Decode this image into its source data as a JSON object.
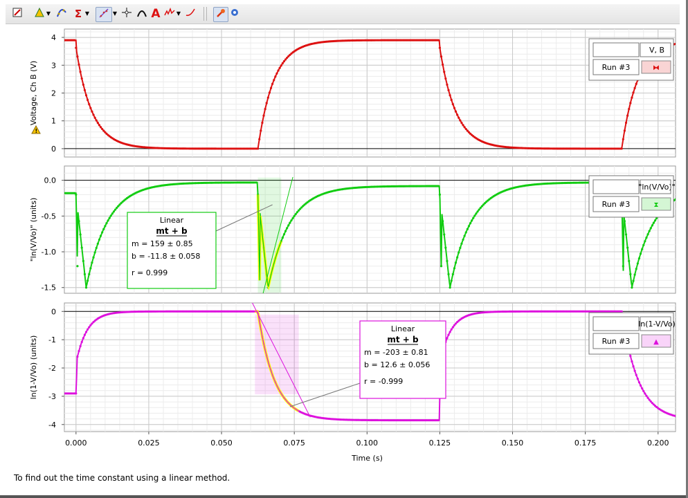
{
  "toolbar": {
    "icons": [
      "view-options-icon",
      "analyze-icon",
      "curve-fit-icon",
      "statistics-icon",
      "integral-icon",
      "linear-fit-icon",
      "crosshair-icon",
      "tangent-icon",
      "annotation-icon",
      "interpolate-icon",
      "model-icon",
      "autoscale-icon",
      "graph-settings-icon"
    ],
    "annotation_glyph": "A",
    "statistics_glyph": "Σ"
  },
  "footer_text": "To find out the time constant using a linear method.",
  "colors": {
    "red": "#dd1111",
    "green": "#11cc11",
    "magenta": "#dd11dd",
    "fit_highlight": "#ffff00",
    "grid_major": "#c8c8c8",
    "grid_minor": "#ececec"
  },
  "chart_data": [
    {
      "type": "line",
      "ylabel": "Voltage, Ch B (V)",
      "xlabel": "",
      "xlim": [
        -0.004,
        0.206
      ],
      "ylim": [
        -0.3,
        4.3
      ],
      "yticks": [
        "0",
        "1",
        "2",
        "3",
        "4"
      ],
      "ytick_values": [
        0,
        1,
        2,
        3,
        4
      ],
      "series": [
        {
          "name": "Run #3",
          "color": "#dd1111",
          "model": "rc_voltage",
          "V0": 3.9,
          "tau": 0.0055,
          "period": 0.125
        }
      ],
      "legend": {
        "header": "V, B",
        "run": "Run #3",
        "symbol": "⧓",
        "placement": "top-right"
      }
    },
    {
      "type": "line",
      "ylabel": "\"ln(V/Vo)\" (units)",
      "xlabel": "",
      "xlim": [
        -0.004,
        0.206
      ],
      "ylim": [
        -1.58,
        0.2
      ],
      "yticks": [
        "0.0",
        "-0.5",
        "-1.0",
        "-1.5"
      ],
      "ytick_values": [
        0,
        -0.5,
        -1.0,
        -1.5
      ],
      "series": [
        {
          "name": "Run #3",
          "color": "#11cc11",
          "model": "ln_v",
          "period": 0.125
        }
      ],
      "legend": {
        "header": "\"ln(V/Vo)\"",
        "run": "Run #3",
        "symbol": "⧗",
        "placement": "top-right"
      },
      "fit": {
        "title": "Linear",
        "formula": "mt + b",
        "m_line": "m = 159   ± 0.85",
        "b_line": "b  = -11.8 ± 0.058",
        "r_line": "r = 0.999",
        "m": 159,
        "b": -11.8,
        "x_range": [
          0.0625,
          0.0705
        ],
        "color": "#11cc11"
      }
    },
    {
      "type": "line",
      "ylabel": "ln(1-V/Vo) (units)",
      "xlabel": "Time (s)",
      "xlim": [
        -0.004,
        0.206
      ],
      "ylim": [
        -4.25,
        0.3
      ],
      "yticks": [
        "0",
        "-1",
        "-2",
        "-3",
        "-4"
      ],
      "ytick_values": [
        0,
        -1,
        -2,
        -3,
        -4
      ],
      "xticks": [
        "0.000",
        "0.025",
        "0.050",
        "0.075",
        "0.100",
        "0.125",
        "0.150",
        "0.175",
        "0.200"
      ],
      "xtick_values": [
        0,
        0.025,
        0.05,
        0.075,
        0.1,
        0.125,
        0.15,
        0.175,
        0.2
      ],
      "series": [
        {
          "name": "Run #3",
          "color": "#dd11dd",
          "model": "ln_1mv",
          "period": 0.125
        }
      ],
      "legend": {
        "header": "ln(1-V/Vo)",
        "run": "Run #3",
        "symbol": "▲",
        "placement": "top-right"
      },
      "fit": {
        "title": "Linear",
        "formula": "mt + b",
        "m_line": "m = -203 ± 0.81",
        "b_line": "b  = 12.6 ± 0.056",
        "r_line": "r = -0.999",
        "m": -203,
        "b": 12.6,
        "x_range": [
          0.0615,
          0.0765
        ],
        "color": "#dd11dd"
      }
    }
  ]
}
